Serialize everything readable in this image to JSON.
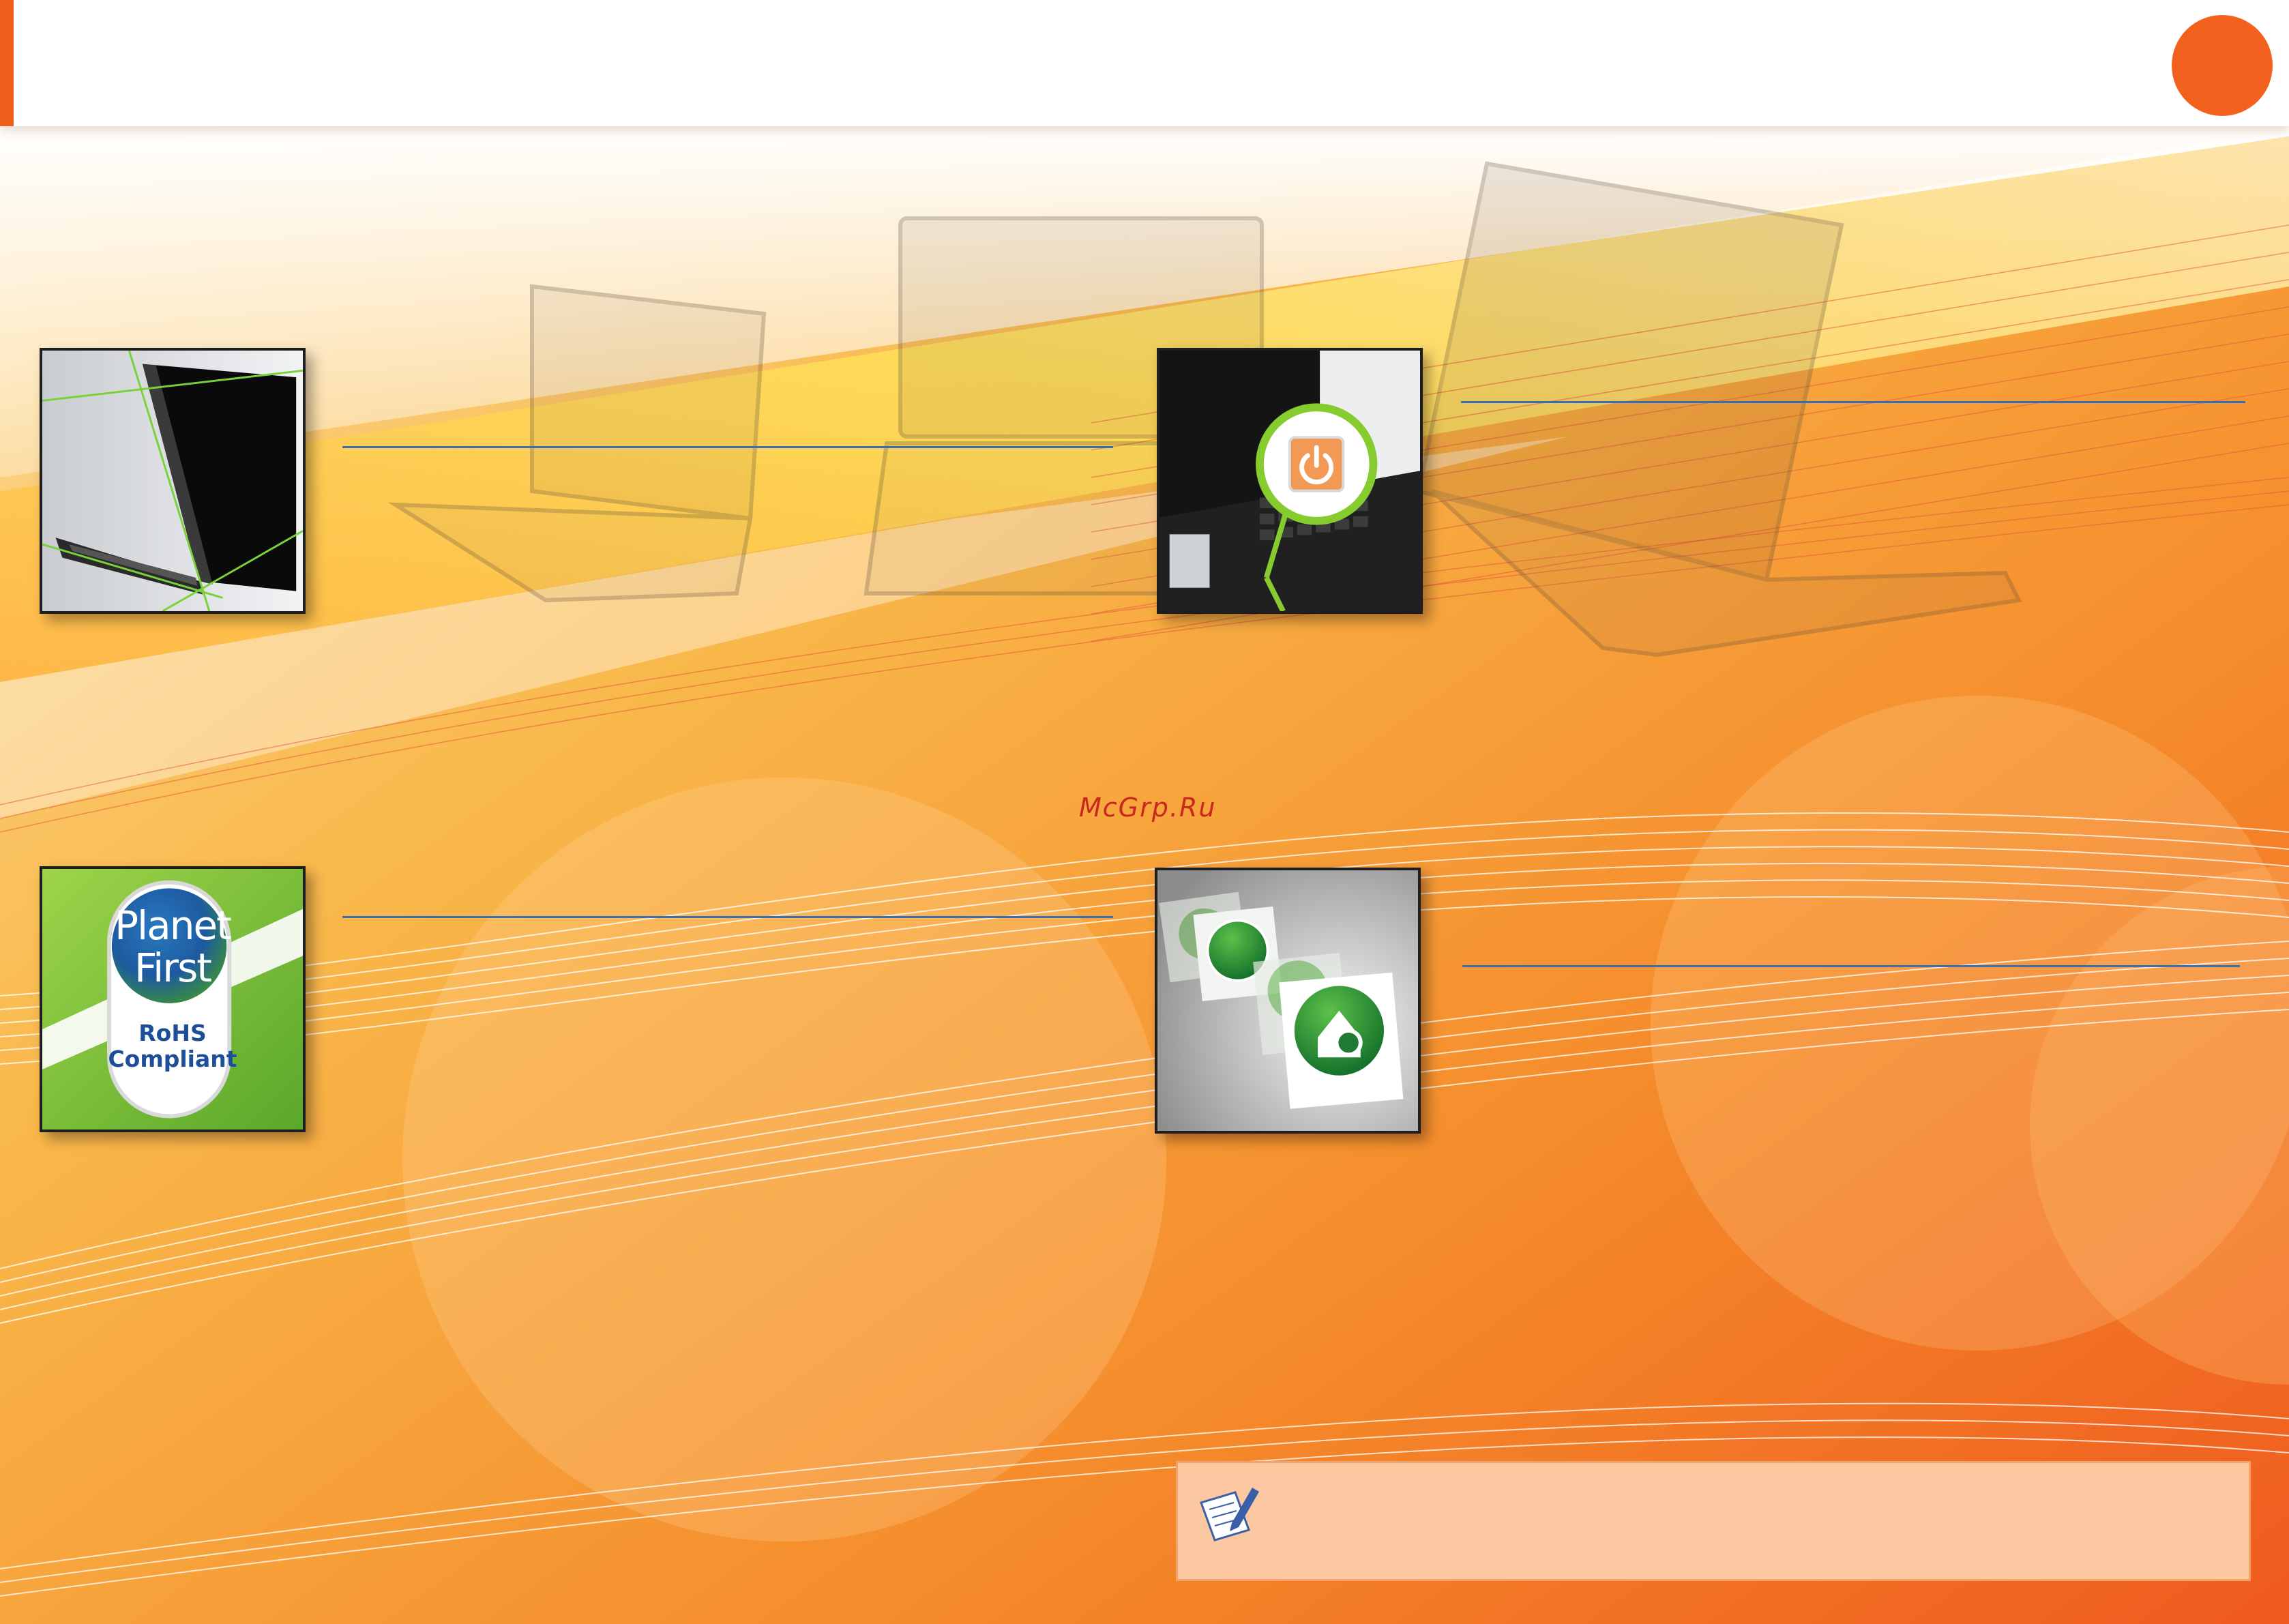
{
  "watermark": "McGrp.Ru",
  "badge": {
    "line1": "Planet",
    "line2": "First",
    "line3": "RoHS",
    "line4": "Compliant"
  },
  "colors": {
    "accent": "#f2611d",
    "leader_line": "#3b6fb3",
    "eco_green": "#7ec13a",
    "note_fill": "#fbc8a2"
  },
  "icons": [
    "power-icon",
    "recovery-icon",
    "note-pencil-icon",
    "planet-first-badge"
  ]
}
